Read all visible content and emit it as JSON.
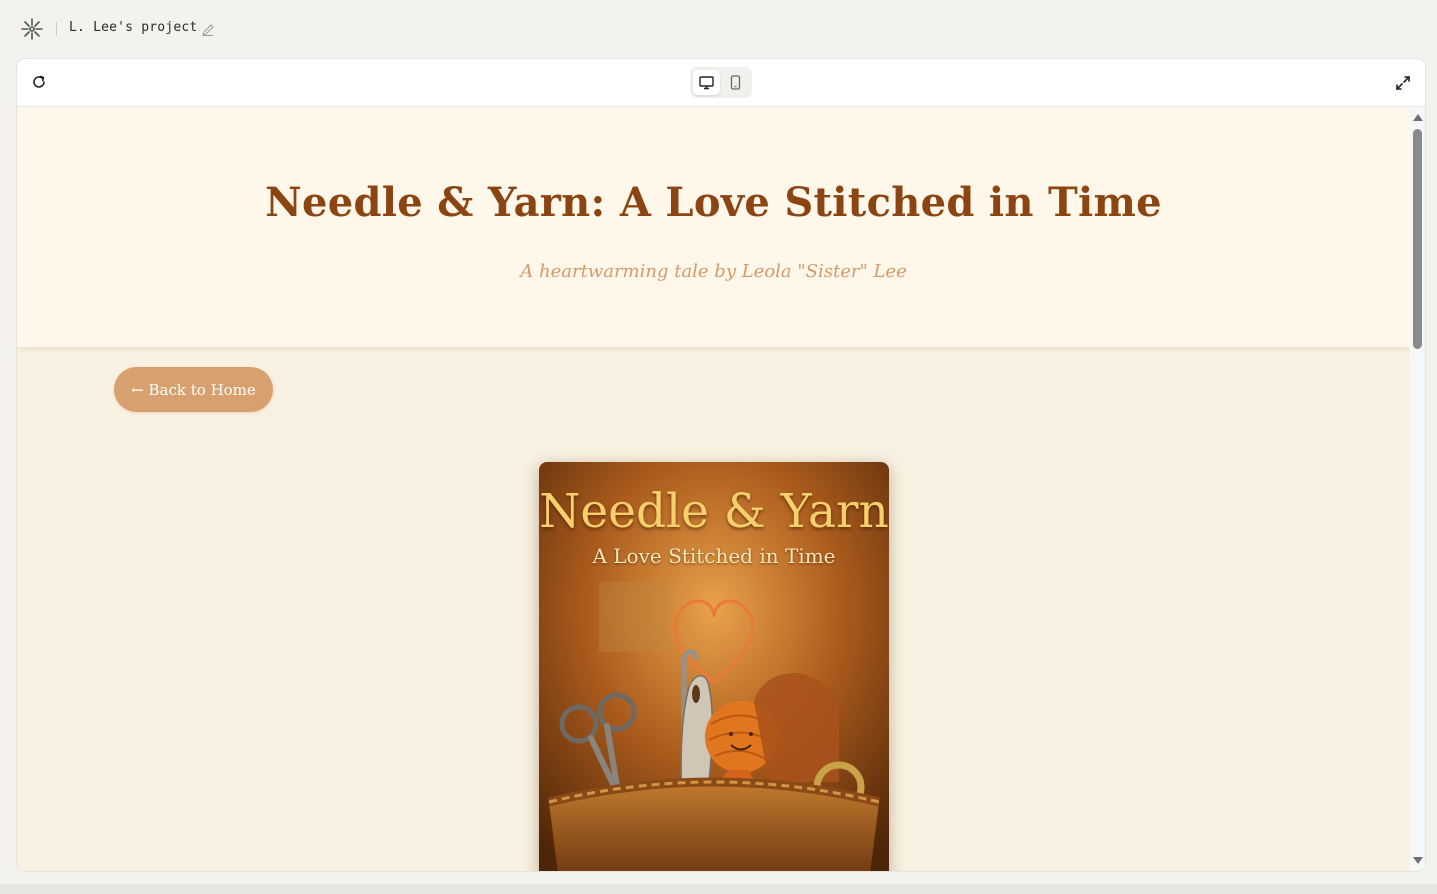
{
  "project": {
    "name": "L. Lee's project"
  },
  "toolbar": {
    "view_modes": [
      "desktop",
      "mobile"
    ],
    "active_view": "desktop"
  },
  "site": {
    "title": "Needle & Yarn: A Love Stitched in Time",
    "subtitle": "A heartwarming tale by Leola \"Sister\" Lee",
    "back_button": "← Back to Home",
    "cover": {
      "title": "Needle & Yarn",
      "subtitle": "A Love Stitched in Time"
    }
  },
  "colors": {
    "title": "#8b4513",
    "subtitle": "#d49a6a",
    "button": "#d9a06f",
    "hero_bg": "#fff7e9",
    "page_bg": "#f9f1e2"
  },
  "icons": [
    "logo-icon",
    "pencil-icon",
    "refresh-icon",
    "desktop-icon",
    "mobile-icon",
    "expand-icon"
  ]
}
